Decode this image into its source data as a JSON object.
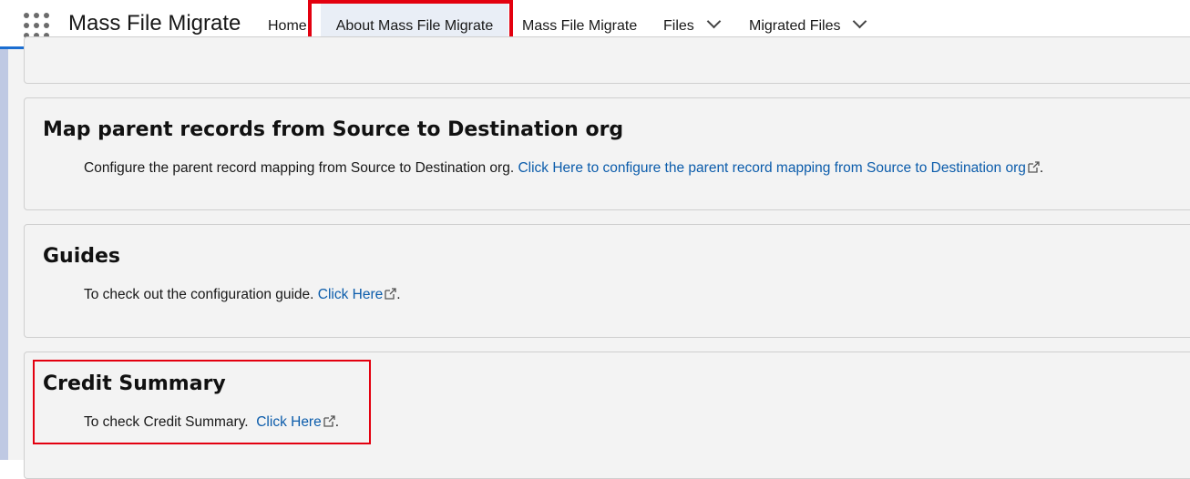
{
  "app": {
    "name": "Mass File Migrate"
  },
  "nav": {
    "items": [
      {
        "label": "Home"
      },
      {
        "label": "About Mass File Migrate"
      },
      {
        "label": "Mass File Migrate"
      },
      {
        "label": "Files"
      },
      {
        "label": "Migrated Files"
      }
    ]
  },
  "sections": {
    "map": {
      "title": "Map parent records from Source to Destination org",
      "text": "Configure the parent record mapping from Source to Destination org.",
      "link": "Click Here to configure the parent record mapping from Source to Destination org",
      "suffix": "."
    },
    "guides": {
      "title": "Guides",
      "text": "To check out the configuration guide.",
      "link": "Click Here",
      "suffix": "."
    },
    "credit": {
      "title": "Credit Summary",
      "text": "To check Credit Summary.",
      "link": "Click Here",
      "suffix": "."
    }
  },
  "colors": {
    "accent": "#0176d3",
    "highlight": "#e3000f",
    "link": "#0b5cab"
  }
}
